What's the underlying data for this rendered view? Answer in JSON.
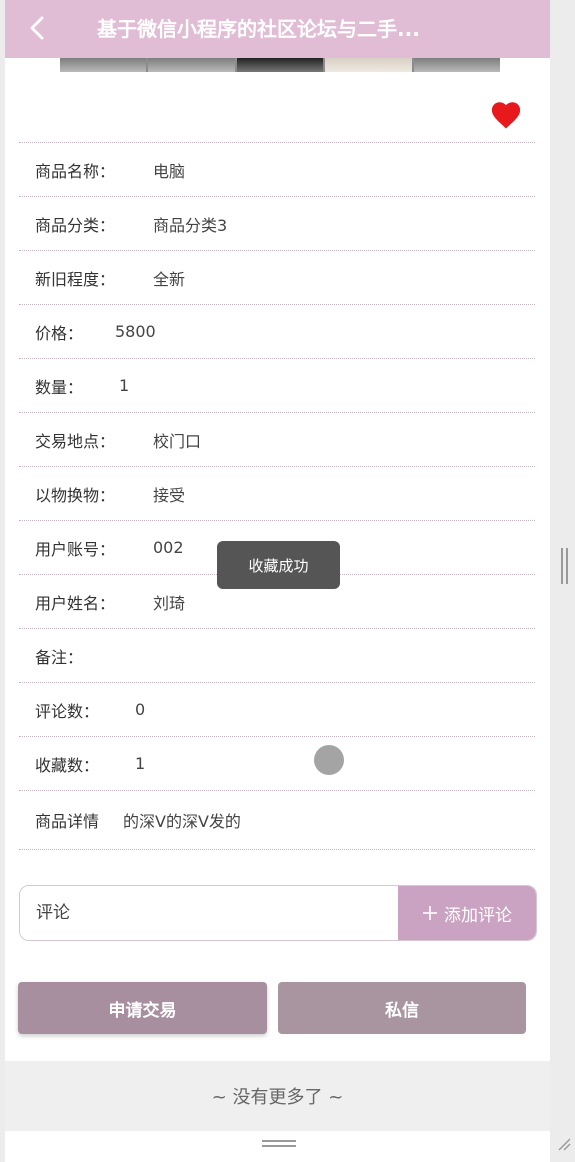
{
  "navbar": {
    "title": "基于微信小程序的社区论坛与二手...",
    "back_icon": "chevron-left-icon"
  },
  "favorite": {
    "icon": "heart-icon",
    "color": "#e8191c",
    "active": true
  },
  "details": [
    {
      "label": "商品名称：",
      "value": "电脑"
    },
    {
      "label": "商品分类：",
      "value": "商品分类3"
    },
    {
      "label": "新旧程度：",
      "value": "全新"
    },
    {
      "label": "价格：",
      "value": "5800"
    },
    {
      "label": "数量：",
      "value": "1"
    },
    {
      "label": "交易地点：",
      "value": "校门口"
    },
    {
      "label": "以物换物：",
      "value": "接受"
    },
    {
      "label": "用户账号：",
      "value": "002"
    },
    {
      "label": "用户姓名：",
      "value": "刘琦"
    },
    {
      "label": "备注：",
      "value": ""
    },
    {
      "label": "评论数：",
      "value": "0"
    },
    {
      "label": "收藏数：",
      "value": "1"
    },
    {
      "label": "商品详情",
      "value": "的深V的深V发的"
    }
  ],
  "toast": {
    "text": "收藏成功"
  },
  "comment": {
    "placeholder": "评论",
    "add_label": "添加评论",
    "add_icon": "plus-icon"
  },
  "actions": {
    "apply_label": "申请交易",
    "message_label": "私信"
  },
  "footer": {
    "text": "~ 没有更多了 ~"
  },
  "colors": {
    "navbar": "#e0bcd5",
    "accent": "#cba3c2",
    "button": "#a78f9f"
  }
}
